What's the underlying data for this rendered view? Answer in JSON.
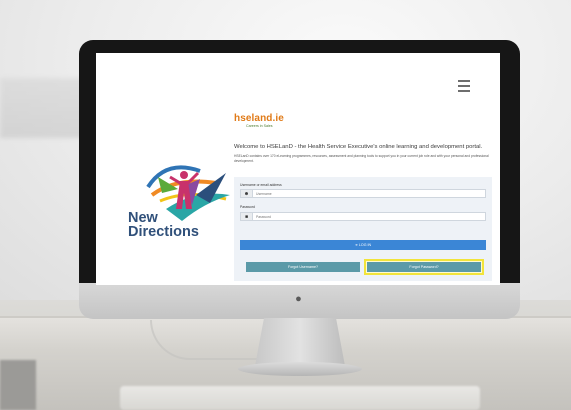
{
  "screen": {
    "menu_icon": "hamburger-menu-icon",
    "brand": {
      "name": "hseland.ie",
      "tagline": "Careers in Sales",
      "color": "#e07a17"
    },
    "welcome_heading": "Welcome to HSELanD - the Health Service Executive's online learning and development portal.",
    "intro_text": "HSELanD contains over 170 eLearning programmes, resources, assessment and planning tools to support you in your current job role and with your personal and professional development.",
    "logo": {
      "text_line1": "New",
      "text_line2": "Directions"
    },
    "login": {
      "username_label": "Username or email address",
      "username_placeholder": "Username",
      "username_icon": "user-icon",
      "password_label": "Password",
      "password_placeholder": "Password",
      "password_icon": "lock-icon",
      "login_button": "➜ LOG IN",
      "forgot_username_button": "Forgot Username?",
      "forgot_password_button": "Forgot Password?",
      "highlight_color": "#f2e43a",
      "login_color": "#3b86d6",
      "secondary_color": "#5b9aa8"
    }
  }
}
